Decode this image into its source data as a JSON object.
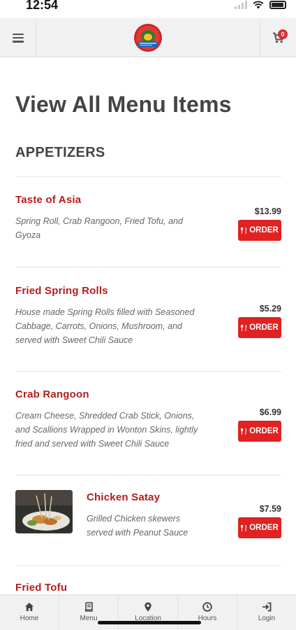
{
  "status_bar": {
    "time": "12:54"
  },
  "header": {
    "cart_count": "0"
  },
  "page": {
    "title": "View All Menu Items",
    "section": "APPETIZERS"
  },
  "items": [
    {
      "name": "Taste of Asia",
      "description": "Spring Roll, Crab Rangoon, Fried Tofu, and Gyoza",
      "price": "$13.99",
      "order_label": "ORDER"
    },
    {
      "name": "Fried Spring Rolls",
      "description": "House made Spring Rolls filled with Seasoned Cabbage, Carrots, Onions, Mushroom, and served with Sweet Chili Sauce",
      "price": "$5.29",
      "order_label": "ORDER"
    },
    {
      "name": "Crab Rangoon",
      "description": "Cream Cheese, Shredded Crab Stick, Onions, and Scallions Wrapped in Wonton Skins, lightly fried and served with Sweet Chili Sauce",
      "price": "$6.99",
      "order_label": "ORDER"
    },
    {
      "name": "Chicken Satay",
      "description": "Grilled Chicken skewers served with Peanut Sauce",
      "price": "$7.59",
      "order_label": "ORDER"
    },
    {
      "name": "Fried Tofu"
    }
  ],
  "bottom_nav": [
    {
      "label": "Home",
      "icon": "home-icon"
    },
    {
      "label": "Menu",
      "icon": "book-icon"
    },
    {
      "label": "Location",
      "icon": "map-pin-icon"
    },
    {
      "label": "Hours",
      "icon": "clock-icon"
    },
    {
      "label": "Login",
      "icon": "sign-in-icon"
    }
  ],
  "colors": {
    "accent": "#e02222",
    "item_name": "#b71c1c",
    "header_bg": "#f1f1f1"
  }
}
